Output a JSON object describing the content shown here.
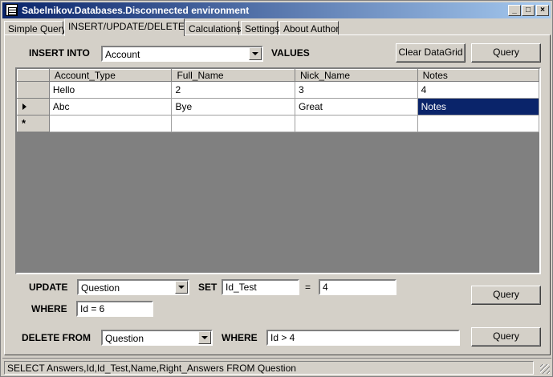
{
  "window": {
    "title": "Sabelnikov.Databases.Disconnected environment"
  },
  "tabs": [
    {
      "label": "Simple Query"
    },
    {
      "label": "INSERT/UPDATE/DELETE"
    },
    {
      "label": "Calculations"
    },
    {
      "label": "Settings"
    },
    {
      "label": "About Author"
    }
  ],
  "insert": {
    "label": "INSERT INTO",
    "table_value": "Account",
    "values_label": "VALUES",
    "clear_button": "Clear DataGrid",
    "query_button": "Query"
  },
  "grid": {
    "columns": [
      "Account_Type",
      "Full_Name",
      "Nick_Name",
      "Notes"
    ],
    "rows": [
      [
        "Hello",
        "2",
        "3",
        "4"
      ],
      [
        "Abc",
        "Bye",
        "Great",
        "Notes"
      ]
    ]
  },
  "update": {
    "label": "UPDATE",
    "table_value": "Question",
    "set_label": "SET",
    "set_field": "Id_Test",
    "equals": "=",
    "set_value": "4",
    "where_label": "WHERE",
    "where_value": "Id = 6",
    "query_button": "Query"
  },
  "delete": {
    "label": "DELETE FROM",
    "table_value": "Question",
    "where_label": "WHERE",
    "where_value": "Id > 4",
    "query_button": "Query"
  },
  "status": {
    "text": "SELECT Answers,Id,Id_Test,Name,Right_Answers FROM Question"
  }
}
